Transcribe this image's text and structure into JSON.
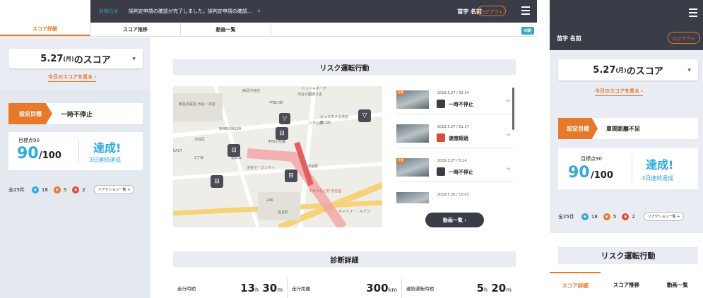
{
  "notice": {
    "label": "お知らせ",
    "text": "誤判定申請の確認が完了しました。誤判定申請の確認…"
  },
  "user": {
    "name": "苗字 名前",
    "logout": "ログアウト"
  },
  "tabs": [
    "スコア詳細",
    "スコア推移",
    "動画一覧"
  ],
  "print_label": "印刷",
  "score_date": {
    "date": "5.27",
    "weekday": "(月)",
    "suffix": "のスコア"
  },
  "today_link": "今日のスコアを見る ›",
  "goal": {
    "tag": "設定目標",
    "text": "一時不停止",
    "mobile_text": "車間距離不足"
  },
  "score": {
    "target_label": "目標点90",
    "value": "90",
    "max": "/100",
    "achieved": "達成!",
    "streak": "3日連続達成"
  },
  "reactions": {
    "total": "全25件",
    "a": "18",
    "b": "5",
    "c": "2",
    "button": "リアクション一覧 +"
  },
  "risk": {
    "title": "リスク運転行動",
    "items": [
      {
        "date": "2019.5.27 / 02:24",
        "label": "一時不停止",
        "tag": "注意",
        "color": "#3a3c48"
      },
      {
        "date": "2019.5.27 / 01:17",
        "label": "速度超過",
        "tag": "",
        "color": "#e0483b"
      },
      {
        "date": "2019.5.27 / 0:14",
        "label": "一時不停止",
        "tag": "注意",
        "color": "#3a3c48"
      },
      {
        "date": "2019.5.26 / 10:03",
        "label": "",
        "tag": "",
        "color": "#3a3c48"
      }
    ],
    "video_button": "動画一覧 ›"
  },
  "map_labels": [
    "西武渋谷店",
    "ドン・キホーテ",
    "渋谷公園通り店",
    "東急百貨店 渋谷・本店",
    "ビックカメラ渋谷",
    "東口店",
    "SHIBUYA109",
    "宇田川交番",
    "ハチ公像",
    "渋谷マークシティ",
    "EAST",
    "渋谷区",
    "宇田川町",
    "渋谷駅",
    "桜丘町",
    "牛かつもと村 渋谷店",
    "ギャラリー・ルデコ",
    "1丁目",
    "道玄坂",
    "246"
  ],
  "diag": {
    "title": "診断詳細",
    "stats": [
      {
        "label": "走行時間",
        "v1": "13",
        "u1": "h",
        "v2": "30",
        "u2": "m"
      },
      {
        "label": "走行距離",
        "v1": "300",
        "u1": "km",
        "v2": "",
        "u2": ""
      },
      {
        "label": "連続運転時間",
        "v1": "5",
        "u1": "h",
        "v2": "20",
        "u2": "m"
      }
    ]
  },
  "colors": {
    "accent": "#e8782a",
    "dark": "#3a3c48",
    "blue": "#2eaadc",
    "teal": "#3ba9b5"
  }
}
